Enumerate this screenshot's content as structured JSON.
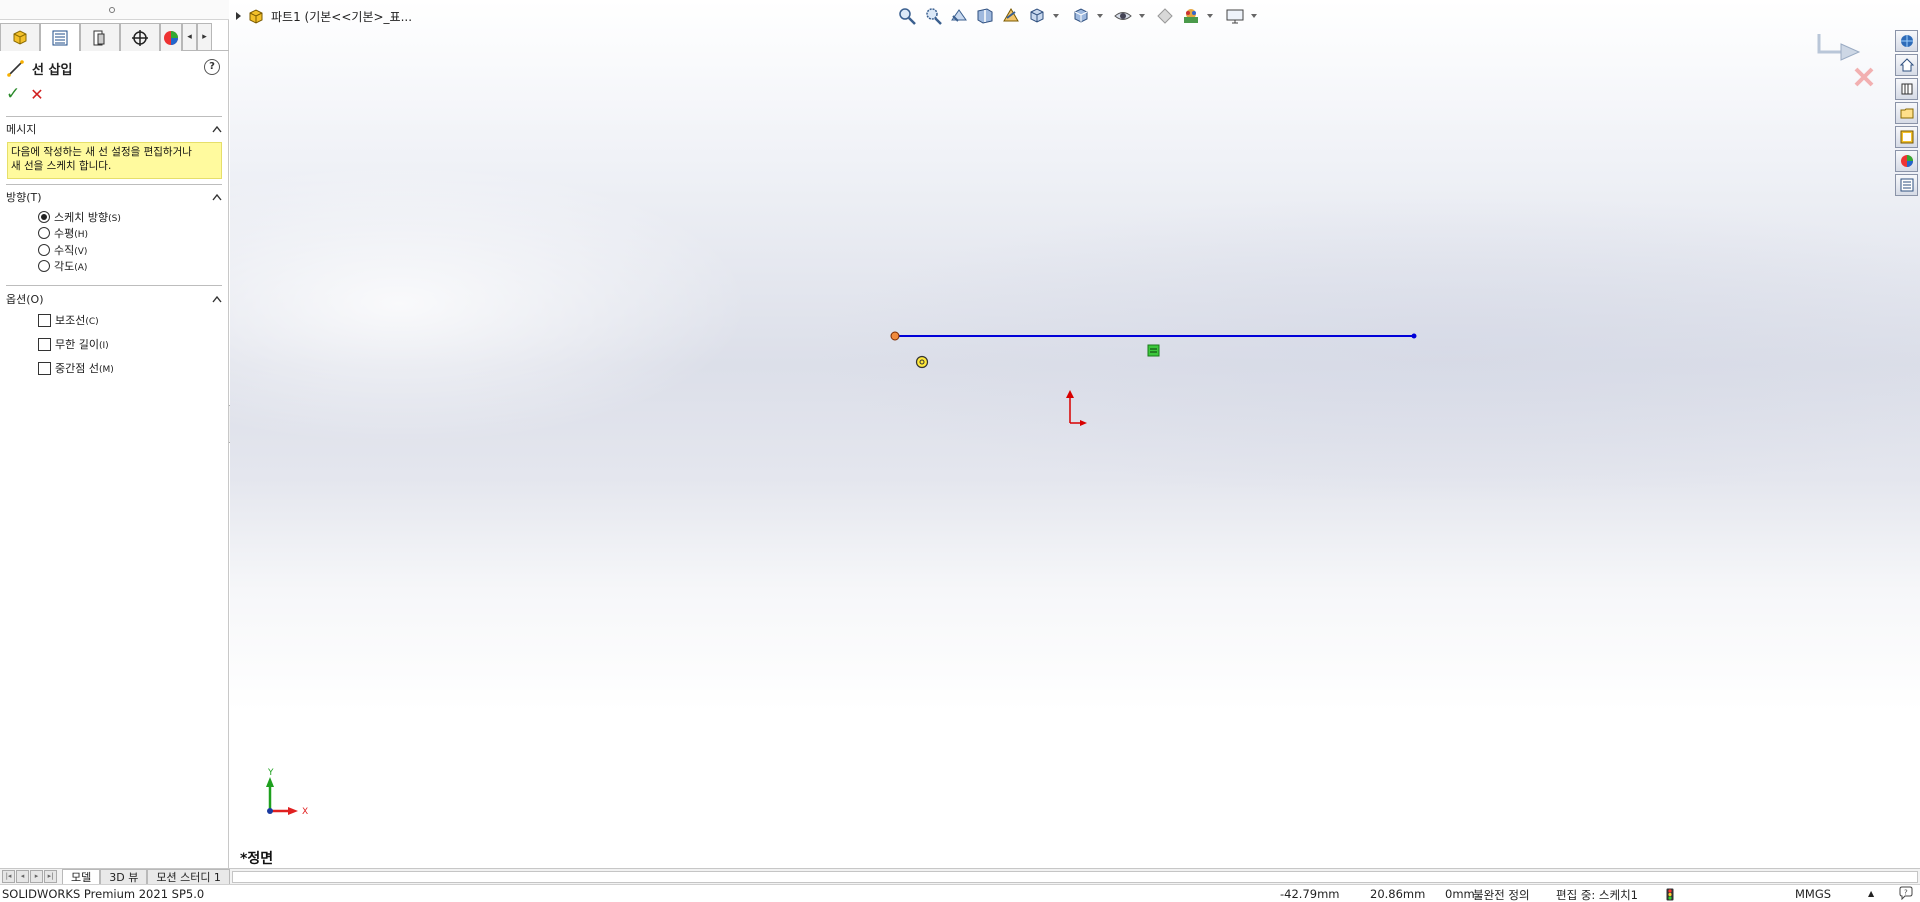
{
  "property_manager": {
    "title": "선 삽입",
    "help": "?",
    "ok": "✓",
    "cancel": "✕",
    "message_group": {
      "label": "메시지",
      "text_line1": "다음에 작성하는 새 선 설정을 편집하거나",
      "text_line2": "새 선을 스케치 합니다."
    },
    "orientation_group": {
      "label": "방향(T)",
      "options": [
        {
          "label": "스케치 방향",
          "key": "(S)",
          "selected": true
        },
        {
          "label": "수평",
          "key": "(H)",
          "selected": false
        },
        {
          "label": "수직",
          "key": "(V)",
          "selected": false
        },
        {
          "label": "각도",
          "key": "(A)",
          "selected": false
        }
      ]
    },
    "options_group": {
      "label": "옵션(O)",
      "options": [
        {
          "label": "보조선",
          "key": "(C)",
          "checked": false
        },
        {
          "label": "무한 길이",
          "key": "(I)",
          "checked": false
        },
        {
          "label": "중간점 선",
          "key": "(M)",
          "checked": false
        }
      ]
    }
  },
  "viewport": {
    "breadcrumb": "파트1  (기본<<기본>_표...",
    "view_name": "*정면",
    "triad": {
      "x_label": "X",
      "y_label": "Y"
    },
    "sketch_line_color": "#0000d8",
    "origin_color": "#d80000"
  },
  "bottom_tabs": [
    "모델",
    "3D 뷰",
    "모션 스터디 1"
  ],
  "status_bar": {
    "product": "SOLIDWORKS Premium 2021 SP5.0",
    "x": "-42.79mm",
    "y": "20.86mm",
    "z": "0mm",
    "definition": "불완전 정의",
    "editing": "편집 중: 스케치1",
    "units": "MMGS",
    "units_caret": "▲"
  }
}
